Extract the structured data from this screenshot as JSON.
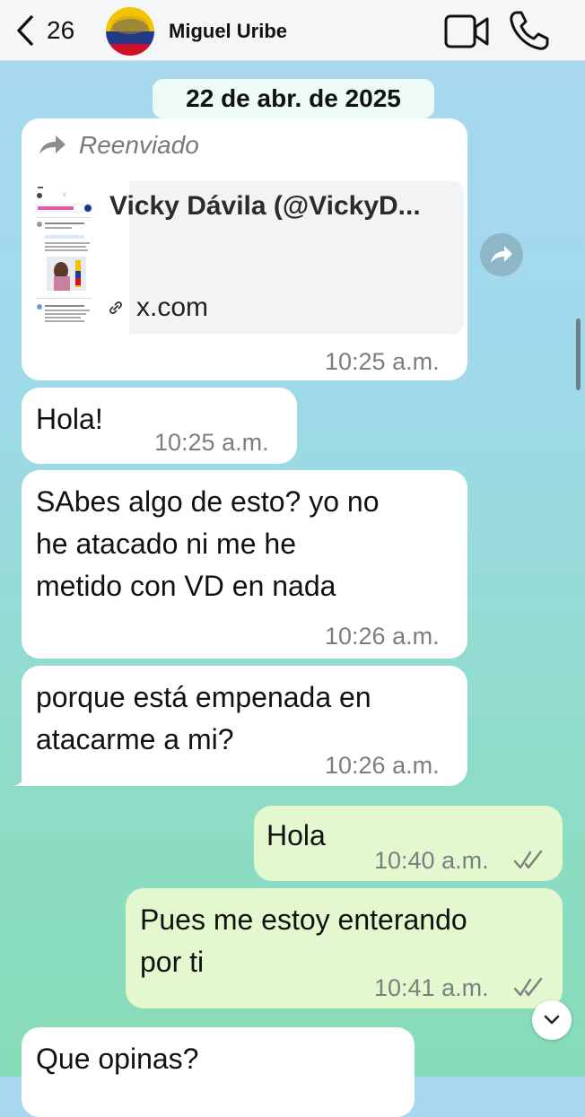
{
  "header": {
    "back_count": "26",
    "contact_name": "Miguel Uribe",
    "avatar_colors": [
      "#f3c300",
      "#1f3a93",
      "#ce1126"
    ]
  },
  "date_separator": "22 de abr. de 2025",
  "messages": [
    {
      "direction": "incoming",
      "forwarded_label": "Reenviado",
      "link": {
        "title": "Vicky Dávila (@VickyD...",
        "domain": "x.com"
      },
      "time": "10:25 a.m."
    },
    {
      "direction": "incoming",
      "text": "Hola!",
      "time": "10:25 a.m."
    },
    {
      "direction": "incoming",
      "text": "SAbes algo de esto? yo no\nhe atacado ni me he\nmetido con VD en nada",
      "time": "10:26 a.m."
    },
    {
      "direction": "incoming",
      "text": "porque está empenada en\natacarme a mi?",
      "time": "10:26 a.m."
    },
    {
      "direction": "outgoing",
      "text": "Hola",
      "time": "10:40 a.m.",
      "status": "read"
    },
    {
      "direction": "outgoing",
      "text": "Pues me estoy enterando\npor ti",
      "time": "10:41 a.m.",
      "status": "read"
    },
    {
      "direction": "incoming",
      "text": "Que opinas?",
      "time": ""
    }
  ],
  "colors": {
    "incoming_bubble": "#ffffff",
    "outgoing_bubble": "#e4f8cf",
    "timestamp": "#7a7f80",
    "header_bg": "#f5f6f7"
  }
}
